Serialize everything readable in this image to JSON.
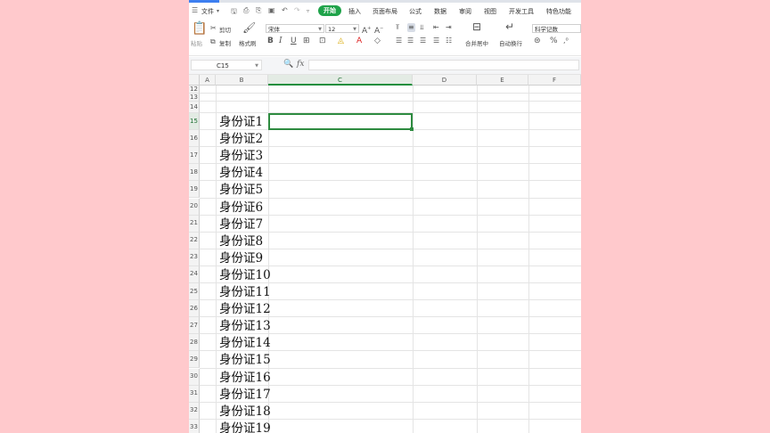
{
  "menu": {
    "file_label": "文件",
    "tabs": [
      "开始",
      "插入",
      "页面布局",
      "公式",
      "数据",
      "审阅",
      "视图",
      "开发工具",
      "特色功能"
    ],
    "active_tab": "开始"
  },
  "ribbon": {
    "paste": "粘贴",
    "cut": "剪切",
    "copy": "复制",
    "format_painter": "格式刷",
    "font_name": "宋体",
    "font_size": "12",
    "merge_center": "合并居中",
    "wrap_text": "自动换行",
    "number_format": "科学记数",
    "bold": "B",
    "italic": "I",
    "underline": "U",
    "percent": "%"
  },
  "formula_bar": {
    "name_box": "C15",
    "fx_label": "fx",
    "formula": ""
  },
  "columns": [
    "A",
    "B",
    "C",
    "D",
    "E",
    "F"
  ],
  "selected_column": "C",
  "rows": [
    {
      "num": "12",
      "text": ""
    },
    {
      "num": "13",
      "text": ""
    },
    {
      "num": "14",
      "text": ""
    },
    {
      "num": "15",
      "text": "身份证1"
    },
    {
      "num": "16",
      "text": "身份证2"
    },
    {
      "num": "17",
      "text": "身份证3"
    },
    {
      "num": "18",
      "text": "身份证4"
    },
    {
      "num": "19",
      "text": "身份证5"
    },
    {
      "num": "20",
      "text": "身份证6"
    },
    {
      "num": "21",
      "text": "身份证7"
    },
    {
      "num": "22",
      "text": "身份证8"
    },
    {
      "num": "23",
      "text": "身份证9"
    },
    {
      "num": "24",
      "text": "身份证10"
    },
    {
      "num": "25",
      "text": "身份证11"
    },
    {
      "num": "26",
      "text": "身份证12"
    },
    {
      "num": "27",
      "text": "身份证13"
    },
    {
      "num": "28",
      "text": "身份证14"
    },
    {
      "num": "29",
      "text": "身份证15"
    },
    {
      "num": "30",
      "text": "身份证16"
    },
    {
      "num": "31",
      "text": "身份证17"
    },
    {
      "num": "32",
      "text": "身份证18"
    },
    {
      "num": "33",
      "text": "身份证19"
    }
  ],
  "selected_row": "15",
  "colors": {
    "accent": "#1fa34a",
    "selection": "#2e8b40",
    "background": "#ffc9cc"
  }
}
